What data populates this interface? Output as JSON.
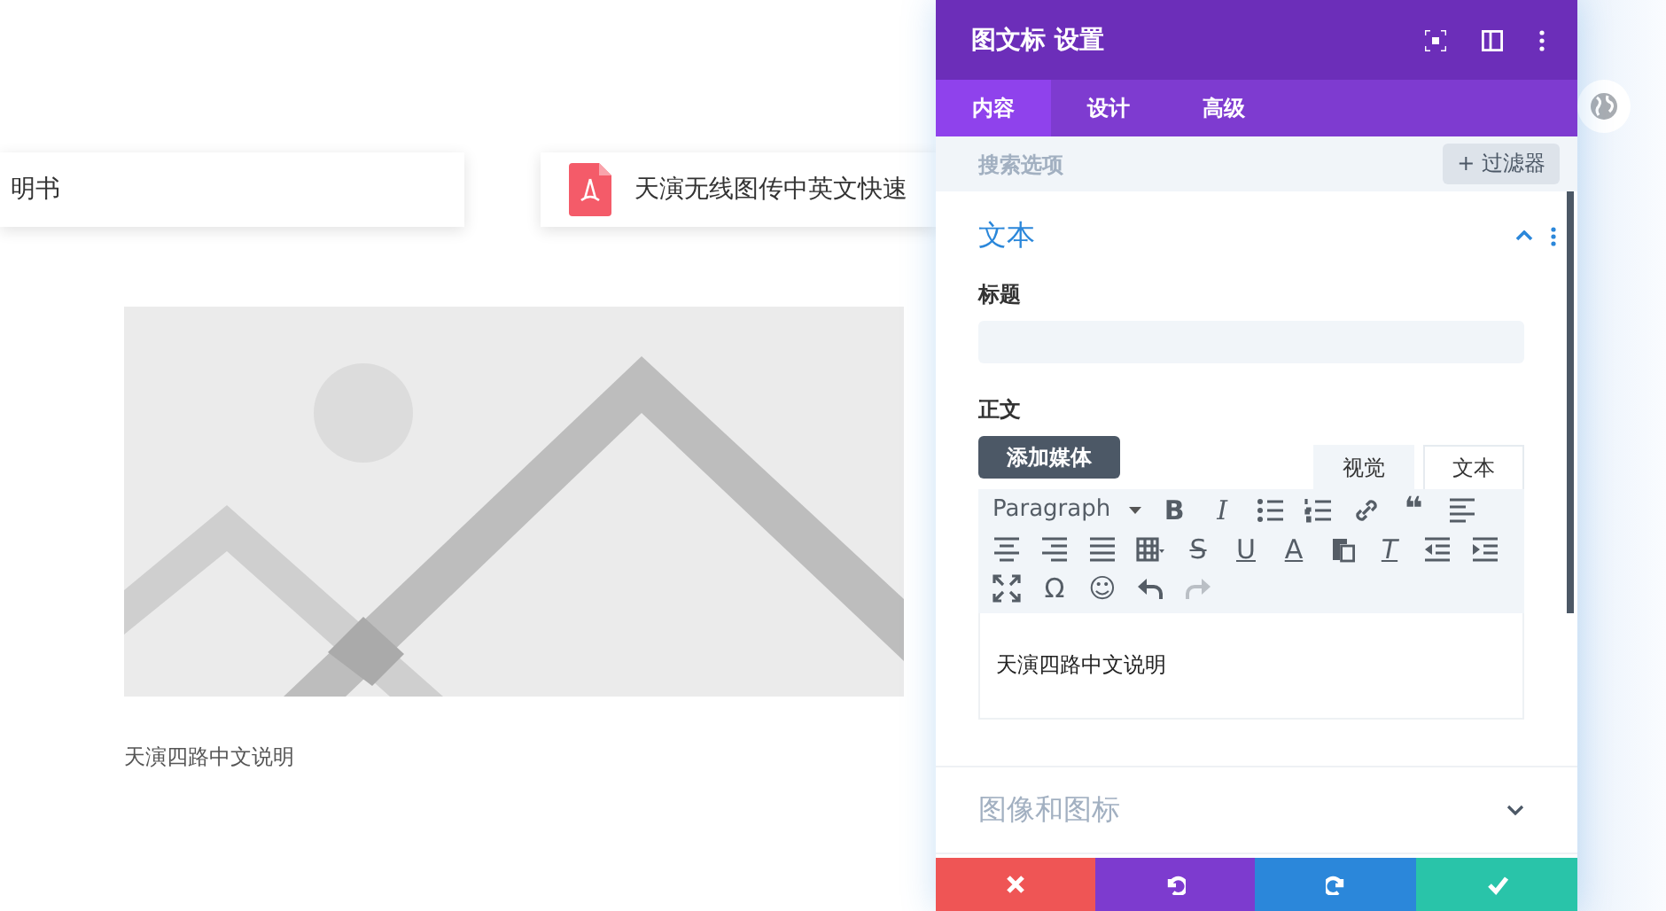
{
  "cards": [
    {
      "text": "明书",
      "kind": "text"
    },
    {
      "text": "天演无线图传中英文快速",
      "kind": "pdf"
    }
  ],
  "image_caption": "天演四路中文说明",
  "panel": {
    "title": "图文标 设置",
    "tabs": [
      {
        "label": "内容",
        "selected": true
      },
      {
        "label": "设计",
        "selected": false
      },
      {
        "label": "高级",
        "selected": false
      }
    ],
    "search": {
      "placeholder": "搜索选项"
    },
    "filter_button": "+ 过滤器",
    "section": {
      "title": "文本",
      "expanded": true,
      "title_field": {
        "label": "标题"
      },
      "body_label": "正文",
      "add_media": "添加媒体",
      "editor_tabs": [
        {
          "label": "视觉",
          "selected": true
        },
        {
          "label": "文本",
          "selected": false
        }
      ],
      "format_select": "Paragraph",
      "toolbar": [
        {
          "kind": "bold",
          "glyph": "B"
        },
        {
          "kind": "italic",
          "glyph": "I"
        },
        {
          "kind": "bullets"
        },
        {
          "kind": "numbers"
        },
        {
          "kind": "link"
        },
        {
          "kind": "quote",
          "glyph": "❝"
        },
        {
          "kind": "left"
        },
        {
          "kind": "center"
        },
        {
          "kind": "right"
        },
        {
          "kind": "justify"
        },
        {
          "kind": "table"
        },
        {
          "kind": "strike",
          "glyph": "S"
        },
        {
          "kind": "underline",
          "glyph": "U"
        },
        {
          "kind": "color",
          "glyph": "A"
        },
        {
          "kind": "paste"
        },
        {
          "kind": "clear",
          "glyph": "T"
        },
        {
          "kind": "outdent"
        },
        {
          "kind": "indent"
        },
        {
          "kind": "fullscreen"
        },
        {
          "kind": "symbol",
          "glyph": "Ω"
        },
        {
          "kind": "emoji",
          "glyph": "☺"
        },
        {
          "kind": "undo",
          "disabled": false
        },
        {
          "kind": "redo",
          "disabled": true
        }
      ],
      "editor_text": "天演四路中文说明"
    },
    "collapsed_section": {
      "title": "图像和图标",
      "expanded": false
    },
    "actions": [
      {
        "kind": "close",
        "color": "#ef5555"
      },
      {
        "kind": "undo",
        "color": "#7d3bcf"
      },
      {
        "kind": "redo",
        "color": "#2b87da"
      },
      {
        "kind": "save",
        "color": "#29c4a9"
      }
    ]
  }
}
